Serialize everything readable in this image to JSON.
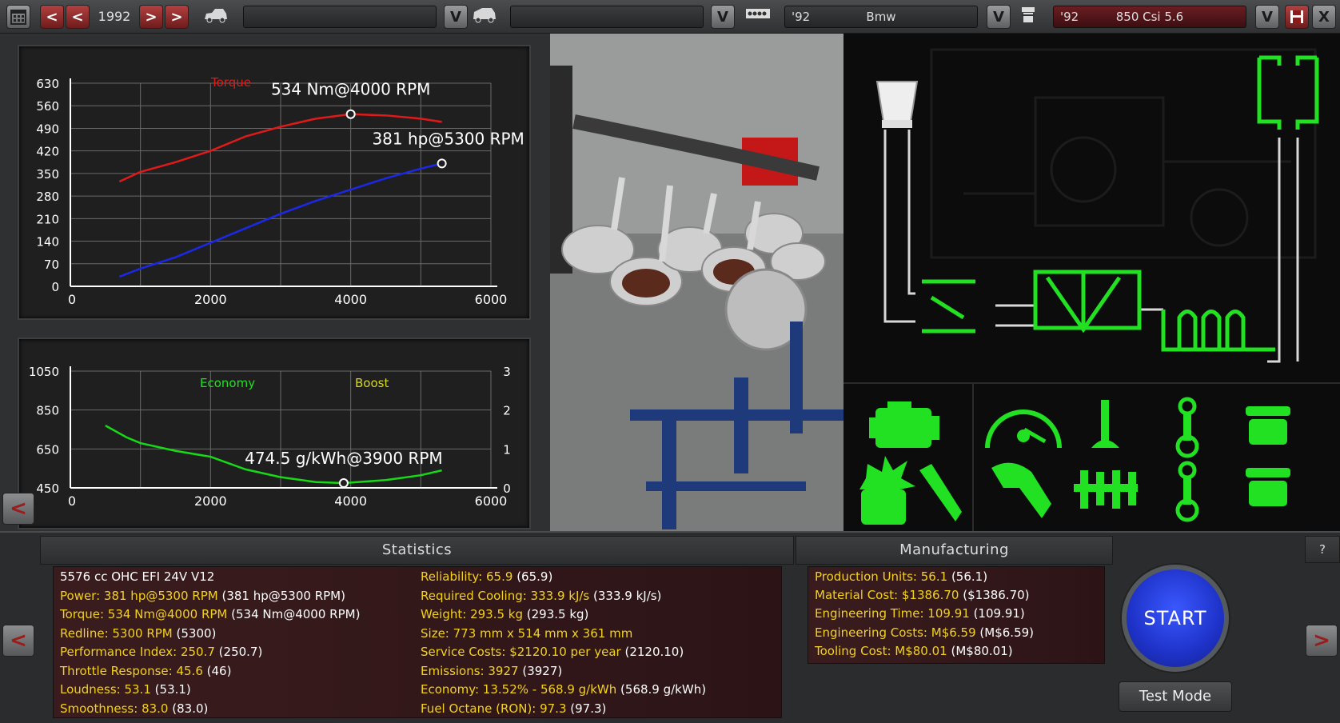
{
  "topbar": {
    "year": "1992",
    "family_year": "'92",
    "family_name": "Bmw",
    "variant_year": "'92",
    "variant_name": "850 Csi 5.6",
    "dropdown_glyph": "V",
    "prev_glyph": "<",
    "next_glyph": ">",
    "close_glyph": "X"
  },
  "chart_data": [
    {
      "type": "line",
      "x_ticks": [
        0,
        2000,
        4000,
        6000
      ],
      "y_ticks": [
        0,
        70,
        140,
        210,
        280,
        350,
        420,
        490,
        560,
        630
      ],
      "xlim": [
        0,
        6000
      ],
      "ylim": [
        0,
        630
      ],
      "grid": true,
      "series": [
        {
          "name": "Torque",
          "color": "#e01a1a",
          "x": [
            700,
            1000,
            1500,
            2000,
            2500,
            3000,
            3500,
            4000,
            4500,
            5000,
            5300
          ],
          "y": [
            325,
            355,
            385,
            420,
            465,
            495,
            520,
            534,
            530,
            520,
            510
          ]
        },
        {
          "color": "#1c28e8",
          "x": [
            700,
            1000,
            1500,
            2000,
            2500,
            3000,
            3500,
            4000,
            4500,
            5000,
            5300
          ],
          "y": [
            30,
            55,
            90,
            135,
            180,
            225,
            265,
            300,
            335,
            365,
            381
          ]
        }
      ],
      "annotations": [
        {
          "text": "534 Nm@4000 RPM",
          "x": 4000,
          "y": 534
        },
        {
          "text": "381 hp@5300 RPM",
          "x": 5300,
          "y": 381
        }
      ]
    },
    {
      "type": "line",
      "x_ticks": [
        0,
        2000,
        4000,
        6000
      ],
      "y_ticks": [
        450,
        650,
        850,
        1050
      ],
      "y2_ticks": [
        0,
        1,
        2,
        3
      ],
      "xlim": [
        0,
        6000
      ],
      "ylim": [
        450,
        1050
      ],
      "grid": true,
      "legend_labels": [
        {
          "text": "Economy",
          "color": "#22e022"
        },
        {
          "text": "Boost",
          "color": "#d8d81e"
        }
      ],
      "series": [
        {
          "name": "Economy",
          "color": "#18d818",
          "x": [
            500,
            800,
            1000,
            1500,
            2000,
            2500,
            3000,
            3500,
            3900,
            4500,
            5000,
            5300
          ],
          "y": [
            770,
            710,
            680,
            640,
            610,
            545,
            505,
            480,
            474.5,
            490,
            515,
            540
          ]
        }
      ],
      "annotations": [
        {
          "text": "474.5 g/kWh@3900 RPM",
          "x": 3900,
          "y": 474.5
        }
      ]
    }
  ],
  "statistics": {
    "title": "Statistics",
    "left": [
      {
        "label": "5576 cc OHC EFI 24V V12",
        "value": ""
      },
      {
        "label": "Power: 381 hp@5300 RPM",
        "value": "(381 hp@5300 RPM)"
      },
      {
        "label": "Torque: 534 Nm@4000 RPM",
        "value": "(534 Nm@4000 RPM)"
      },
      {
        "label": "Redline: 5300 RPM",
        "value": "(5300)"
      },
      {
        "label": "Performance Index: 250.7",
        "value": "(250.7)"
      },
      {
        "label": "Throttle Response: 45.6",
        "value": "(46)"
      },
      {
        "label": "Loudness: 53.1",
        "value": "(53.1)"
      },
      {
        "label": "Smoothness: 83.0",
        "value": "(83.0)"
      }
    ],
    "right": [
      {
        "label": "Reliability: 65.9",
        "value": "(65.9)"
      },
      {
        "label": "Required Cooling: 333.9 kJ/s",
        "value": "(333.9 kJ/s)"
      },
      {
        "label": "Weight: 293.5 kg",
        "value": "(293.5 kg)"
      },
      {
        "label": "Size: 773 mm x 514 mm x 361 mm",
        "value": ""
      },
      {
        "label": "Service Costs: $2120.10 per year",
        "value": "(2120.10)"
      },
      {
        "label": "Emissions: 3927",
        "value": "(3927)"
      },
      {
        "label": "Economy: 13.52% - 568.9 g/kWh",
        "value": "(568.9 g/kWh)"
      },
      {
        "label": "Fuel Octane (RON): 97.3",
        "value": "(97.3)"
      }
    ]
  },
  "manufacturing": {
    "title": "Manufacturing",
    "items": [
      {
        "label": "Production Units: 56.1",
        "value": "(56.1)"
      },
      {
        "label": "Material Cost: $1386.70",
        "value": "($1386.70)"
      },
      {
        "label": "Engineering Time: 109.91",
        "value": "(109.91)"
      },
      {
        "label": "Engineering Costs: M$6.59",
        "value": "(M$6.59)"
      },
      {
        "label": "Tooling Cost: M$80.01",
        "value": "(M$80.01)"
      }
    ]
  },
  "actions": {
    "start": "START",
    "test_mode": "Test Mode",
    "help": "?",
    "back_glyph": "<",
    "forward_glyph": ">"
  },
  "colors": {
    "accent_green": "#22e022",
    "stat_yellow": "#f2d21e",
    "start_blue": "#1e32c8"
  }
}
